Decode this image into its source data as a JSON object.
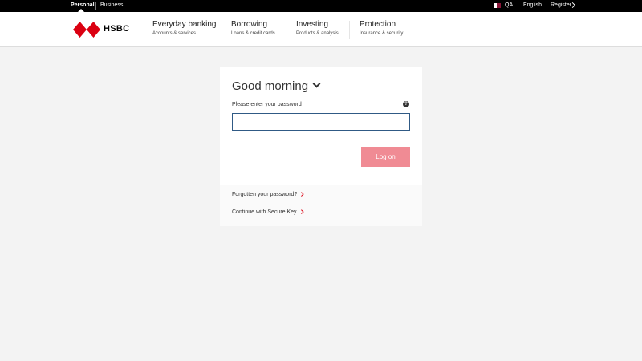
{
  "topbar": {
    "segments": [
      "Personal",
      "Business"
    ],
    "country": "QA",
    "language": "English",
    "register": "Register"
  },
  "header": {
    "logo_text": "HSBC",
    "nav": [
      {
        "title": "Everyday banking",
        "sub": "Accounts & services"
      },
      {
        "title": "Borrowing",
        "sub": "Loans & credit cards"
      },
      {
        "title": "Investing",
        "sub": "Products & analysis"
      },
      {
        "title": "Protection",
        "sub": "Insurance & security"
      }
    ]
  },
  "login": {
    "greeting": "Good morning",
    "password_label": "Please enter your password",
    "help_icon": "?",
    "password_value": "",
    "logon_label": "Log on",
    "links": [
      "Forgotten your password?",
      "Continue with Secure Key"
    ]
  },
  "colors": {
    "brand_red": "#db0011",
    "logon_button": "#f08b94",
    "topbar": "#000000",
    "page_bg": "#f3f3f3"
  }
}
